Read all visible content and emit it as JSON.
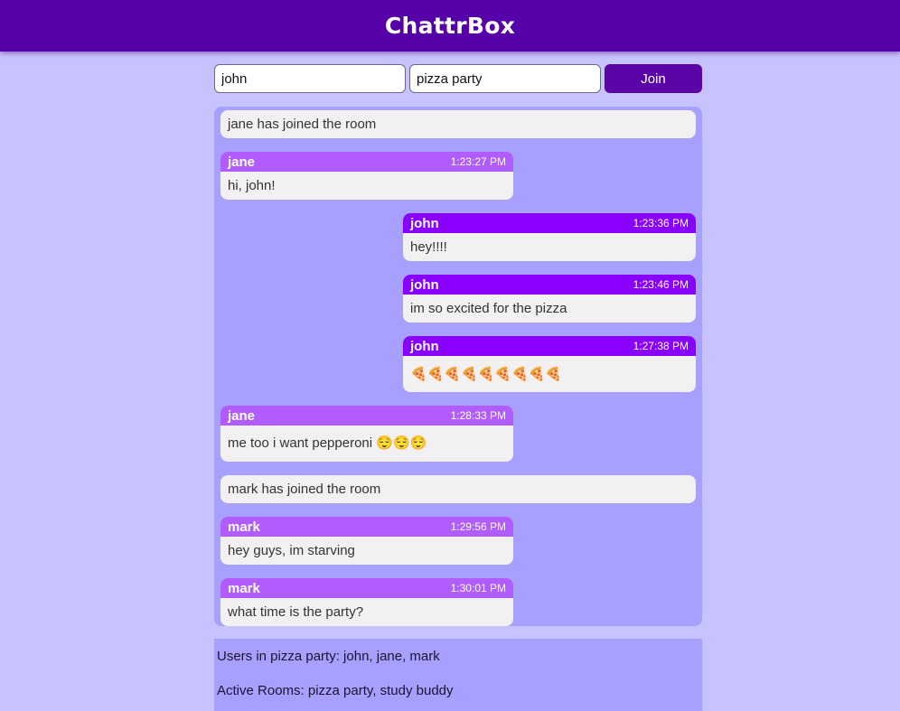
{
  "header": {
    "title": "ChattrBox"
  },
  "join_form": {
    "username_value": "john",
    "room_value": "pizza party",
    "join_label": "Join"
  },
  "messages": [
    {
      "type": "system",
      "text": "jane has joined the room"
    },
    {
      "type": "chat",
      "author": "jane",
      "time": "1:23:27 PM",
      "text": "hi, john!"
    },
    {
      "type": "chat",
      "author": "john",
      "time": "1:23:36 PM",
      "text": "hey!!!!"
    },
    {
      "type": "chat",
      "author": "john",
      "time": "1:23:46 PM",
      "text": "im so excited for the pizza"
    },
    {
      "type": "chat",
      "author": "john",
      "time": "1:27:38 PM",
      "text": "🍕🍕🍕🍕🍕🍕🍕🍕🍕"
    },
    {
      "type": "chat",
      "author": "jane",
      "time": "1:28:33 PM",
      "text": "me too i want pepperoni 😌😌😌"
    },
    {
      "type": "system",
      "text": "mark has joined the room"
    },
    {
      "type": "chat",
      "author": "mark",
      "time": "1:29:56 PM",
      "text": "hey guys, im starving"
    },
    {
      "type": "chat",
      "author": "mark",
      "time": "1:30:01 PM",
      "text": "what time is the party?"
    }
  ],
  "sidebar_info": {
    "users_text": "Users in pizza party: john, jane, mark",
    "rooms_text": "Active Rooms: pizza party, study buddy"
  },
  "colors": {
    "header_bg": "#5500a8",
    "page_bg": "#c7c3fe",
    "panel_bg": "#a7a0ff",
    "other_user_header": "#b05cff",
    "own_user_header": "#8a00ff",
    "bubble_bg": "#f2f0f1"
  }
}
